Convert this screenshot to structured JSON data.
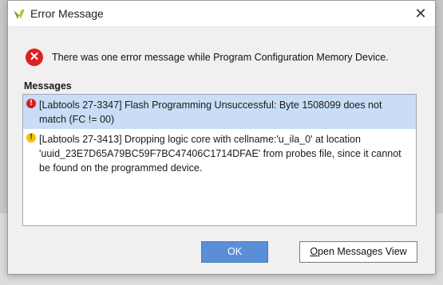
{
  "window": {
    "title": "Error Message",
    "app_icon": "vivado-logo-icon",
    "close_glyph": "✕"
  },
  "summary": {
    "icon": "error-circle-icon",
    "glyph": "✕",
    "text": "There was one error message while Program Configuration Memory Device."
  },
  "messages": {
    "heading": "Messages",
    "items": [
      {
        "severity": "error",
        "icon": "error-icon",
        "glyph": "!",
        "text": "[Labtools 27-3347] Flash Programming Unsuccessful: Byte 1508099 does not match (FC != 00)",
        "selected": true
      },
      {
        "severity": "warning",
        "icon": "warning-icon",
        "glyph": "!",
        "text": "[Labtools 27-3413] Dropping logic core with cellname:'u_ila_0' at location 'uuid_23E7D65A79BC59F7BC47406C1714DFAE' from probes file, since it cannot be found on the programmed device.",
        "selected": false
      }
    ]
  },
  "buttons": {
    "ok": "OK",
    "open_messages_mnemonic": "O",
    "open_messages_rest": "pen Messages View"
  },
  "colors": {
    "accent": "#5a8fd8",
    "selection": "#c9ddf6",
    "error": "#e02020",
    "warning": "#f2c200"
  }
}
